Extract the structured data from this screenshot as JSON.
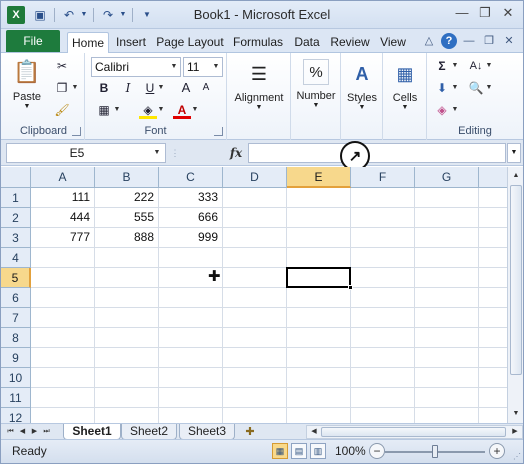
{
  "app": {
    "title": "Book1 - Microsoft Excel",
    "logo_letter": "X"
  },
  "window_controls": {
    "minimize": "—",
    "restore": "❐",
    "close": "✕"
  },
  "ribbon_tabs": {
    "file": "File",
    "items": [
      "Home",
      "Insert",
      "Page Layout",
      "Formulas",
      "Data",
      "Review",
      "View"
    ],
    "active": "Home"
  },
  "ribbon": {
    "clipboard": {
      "label": "Clipboard",
      "paste_label": "Paste"
    },
    "font": {
      "label": "Font",
      "font_name": "Calibri",
      "font_size": "11",
      "bold": "B",
      "italic": "I",
      "underline": "U",
      "grow": "A",
      "shrink": "A",
      "font_color_glyph": "A"
    },
    "alignment": {
      "label": "Alignment"
    },
    "number": {
      "label": "Number",
      "glyph": "%"
    },
    "styles": {
      "label": "Styles"
    },
    "cells": {
      "label": "Cells"
    },
    "editing": {
      "label": "Editing",
      "sum_glyph": "Σ"
    }
  },
  "formula_bar": {
    "name_box": "E5",
    "fx_label": "fx",
    "formula": ""
  },
  "sheet": {
    "columns": [
      "A",
      "B",
      "C",
      "D",
      "E",
      "F",
      "G"
    ],
    "selected_column": "E",
    "rows": [
      "1",
      "2",
      "3",
      "4",
      "5",
      "6",
      "7",
      "8",
      "9",
      "10",
      "11",
      "12"
    ],
    "selected_row": "5",
    "cells": [
      [
        "111",
        "222",
        "333"
      ],
      [
        "444",
        "555",
        "666"
      ],
      [
        "777",
        "888",
        "999"
      ]
    ],
    "active_cell": "E5"
  },
  "sheet_tabs": {
    "tabs": [
      "Sheet1",
      "Sheet2",
      "Sheet3"
    ],
    "active": "Sheet1"
  },
  "status_bar": {
    "status": "Ready",
    "zoom": "100%",
    "zoom_level_percent": 100
  }
}
